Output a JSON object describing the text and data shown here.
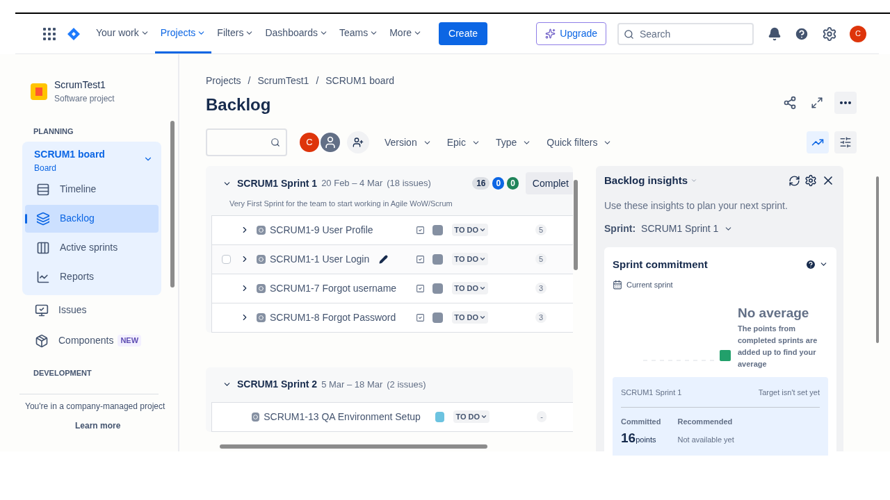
{
  "nav": {
    "items": [
      {
        "label": "Your work",
        "selected": false
      },
      {
        "label": "Projects",
        "selected": true
      },
      {
        "label": "Filters",
        "selected": false
      },
      {
        "label": "Dashboards",
        "selected": false
      },
      {
        "label": "Teams",
        "selected": false
      },
      {
        "label": "More",
        "selected": false
      }
    ],
    "create": "Create",
    "upgrade": "Upgrade",
    "search": {
      "placeholder": "Search"
    },
    "avatar": "C"
  },
  "sidebar": {
    "project": {
      "name": "ScrumTest1",
      "type": "Software project"
    },
    "planning_heading": "PLANNING",
    "board": {
      "name": "SCRUM1 board",
      "type": "Board",
      "expanded": true
    },
    "board_items": [
      {
        "label": "Timeline",
        "kind": "timeline",
        "selected": false
      },
      {
        "label": "Backlog",
        "kind": "backlog",
        "selected": true
      },
      {
        "label": "Active sprints",
        "kind": "sprints",
        "selected": false
      },
      {
        "label": "Reports",
        "kind": "reports",
        "selected": false
      }
    ],
    "items": [
      {
        "label": "Issues",
        "kind": "issues"
      },
      {
        "label": "Components",
        "kind": "components",
        "badge": "NEW"
      }
    ],
    "development_heading": "DEVELOPMENT",
    "footer": "You're in a company-managed project",
    "learn_more": "Learn more"
  },
  "breadcrumbs": [
    "Projects",
    "ScrumTest1",
    "SCRUM1 board"
  ],
  "breadcrumb_separator": "/",
  "title": "Backlog",
  "filters": {
    "avatar": "C",
    "items": [
      "Version",
      "Epic",
      "Type",
      "Quick filters"
    ],
    "insights_on": true
  },
  "sprints": [
    {
      "name": "SCRUM1 Sprint 1",
      "dates": "20 Feb – 4 Mar",
      "count": "(18 issues)",
      "goal": "Very First Sprint for the team to start working in Agile WoW/Scrum",
      "todo": "16",
      "progress": "0",
      "done": "0",
      "action": "Complet",
      "issues": [
        {
          "key": "SCRUM1-9",
          "summary": "User Profile",
          "subtasks": true,
          "color": "#8590a2",
          "status": "TO DO",
          "points": "5",
          "hovered": false
        },
        {
          "key": "SCRUM1-1",
          "summary": "User Login",
          "subtasks": true,
          "color": "#8590a2",
          "status": "TO DO",
          "points": "5",
          "hovered": true
        },
        {
          "key": "SCRUM1-7",
          "summary": "Forgot username",
          "subtasks": true,
          "color": "#8590a2",
          "status": "TO DO",
          "points": "3",
          "hovered": false
        },
        {
          "key": "SCRUM1-8",
          "summary": "Forgot Password",
          "subtasks": true,
          "color": "#8590a2",
          "status": "TO DO",
          "points": "3",
          "hovered": false
        }
      ]
    },
    {
      "name": "SCRUM1 Sprint 2",
      "dates": "5 Mar – 18 Mar",
      "count": "(2 issues)",
      "issues": [
        {
          "key": "SCRUM1-13",
          "summary": "QA Environment Setup",
          "subtasks": false,
          "color": "#6cc3e0",
          "status": "TO DO",
          "points": "-",
          "hovered": false
        }
      ]
    }
  ],
  "insights": {
    "title": "Backlog insights",
    "subtitle": "Use these insights to plan your next sprint.",
    "sprint_label": "Sprint:",
    "sprint": "SCRUM1 Sprint 1",
    "card": {
      "title": "Sprint commitment",
      "period": "Current sprint",
      "headline": "No average",
      "text": "The points from completed sprints are added up to find your average",
      "tooltip": {
        "sprint": "SCRUM1 Sprint 1",
        "target": "Target isn't set yet",
        "committed_label": "Committed",
        "committed": "16",
        "unit": "points",
        "recommended_label": "Recommended",
        "recommended": "Not available yet"
      }
    }
  }
}
